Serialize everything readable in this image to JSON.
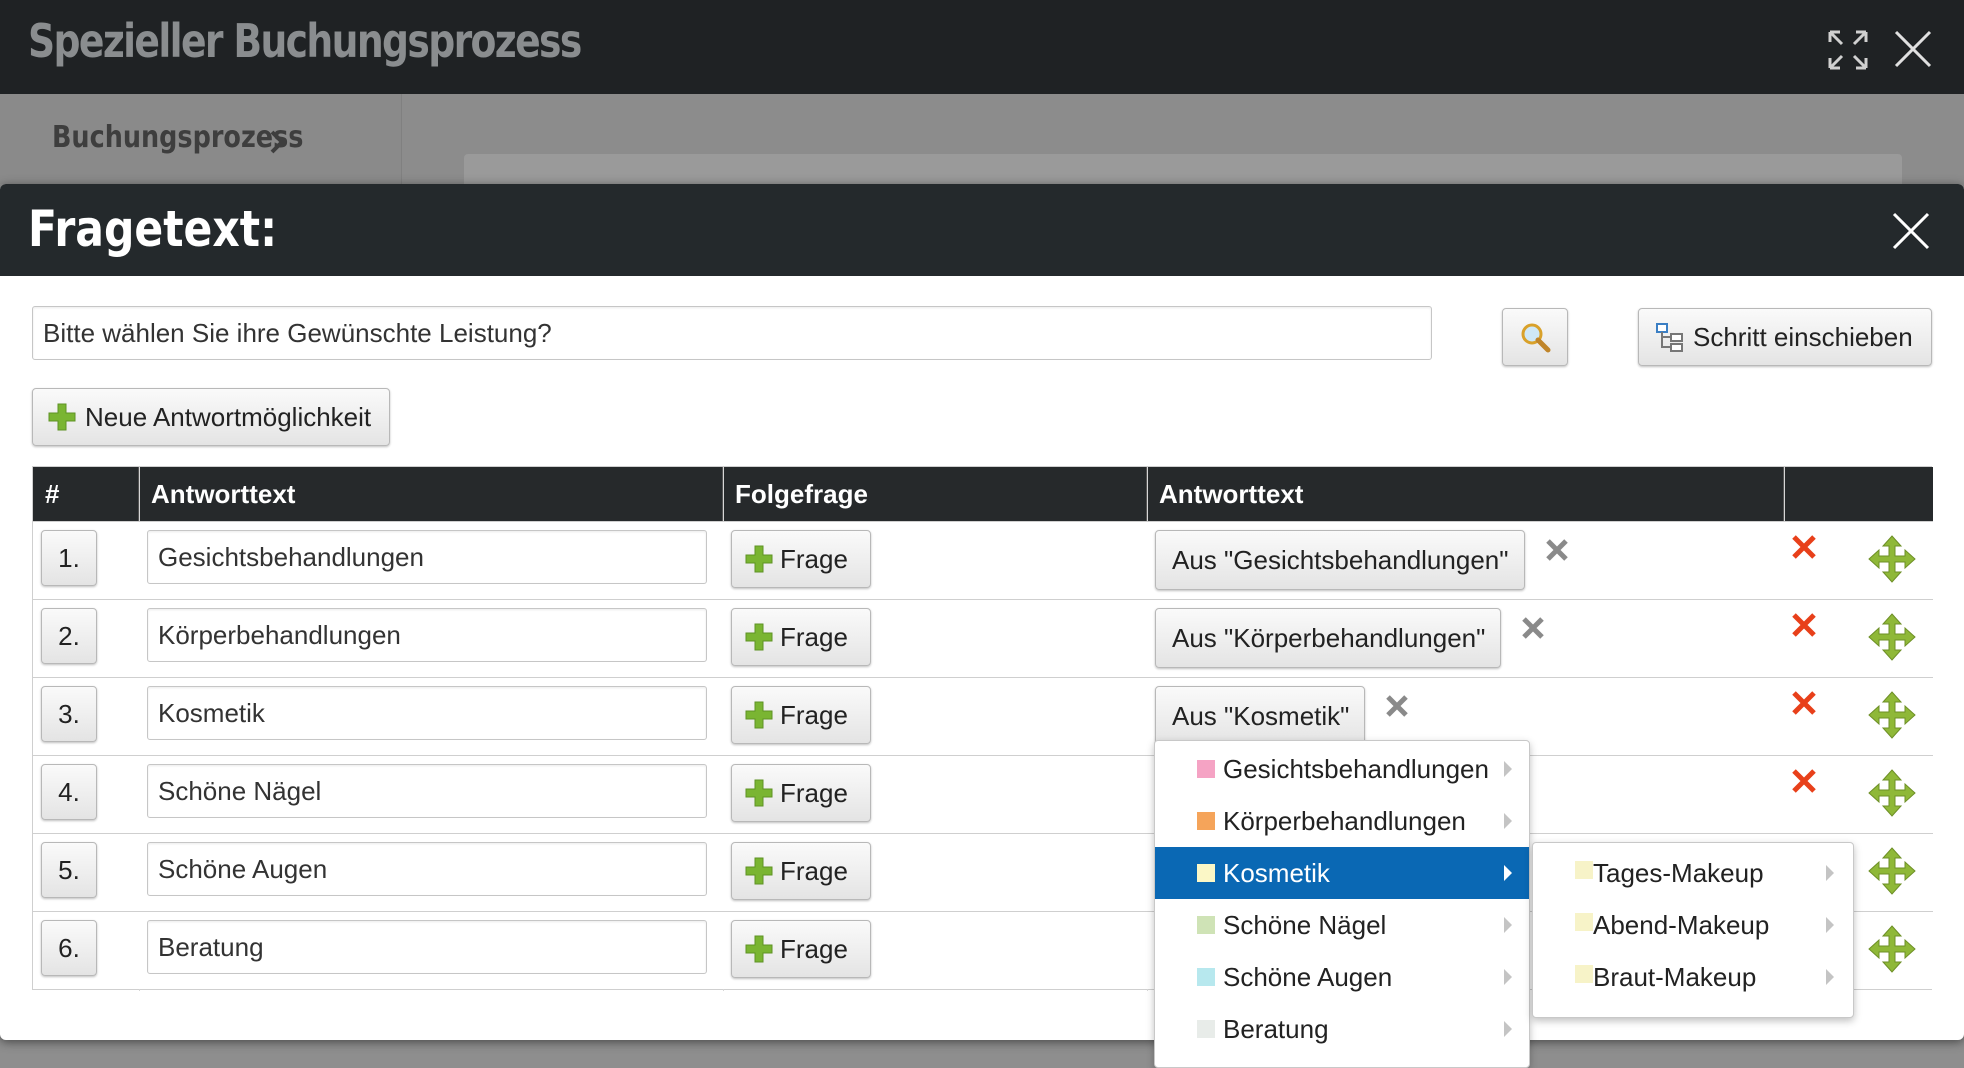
{
  "outer_window": {
    "title": "Spezieller Buchungsprozess",
    "breadcrumb": "Buchungsprozess"
  },
  "modal": {
    "title": "Fragetext:",
    "question_value": "Bitte wählen Sie ihre Gewünschte Leistung?",
    "insert_step_label": "Schritt einschieben",
    "new_answer_label": "Neue Antwortmöglichkeit"
  },
  "table": {
    "headers": [
      "#",
      "Antworttext",
      "Folgefrage",
      "Antworttext",
      ""
    ],
    "followup_label": "Frage",
    "rows": [
      {
        "num": "1.",
        "answer": "Gesichtsbehandlungen",
        "source": "Aus \"Gesichtsbehandlungen\""
      },
      {
        "num": "2.",
        "answer": "Körperbehandlungen",
        "source": "Aus \"Körperbehandlungen\""
      },
      {
        "num": "3.",
        "answer": "Kosmetik",
        "source": "Aus \"Kosmetik\""
      },
      {
        "num": "4.",
        "answer": "Schöne Nägel",
        "source": ""
      },
      {
        "num": "5.",
        "answer": "Schöne Augen",
        "source": ""
      },
      {
        "num": "6.",
        "answer": "Beratung",
        "source": ""
      }
    ]
  },
  "dropdown": {
    "items": [
      {
        "label": "Gesichtsbehandlungen",
        "color": "#f5a3c4"
      },
      {
        "label": "Körperbehandlungen",
        "color": "#f5a45a"
      },
      {
        "label": "Kosmetik",
        "color": "#fbf7c6"
      },
      {
        "label": "Schöne Nägel",
        "color": "#cfe3b6"
      },
      {
        "label": "Schöne Augen",
        "color": "#b7e8ee"
      },
      {
        "label": "Beratung",
        "color": "#e8ece9"
      }
    ],
    "active": "Kosmetik"
  },
  "submenu": {
    "items": [
      "Tages-Makeup",
      "Abend-Makeup",
      "Braut-Makeup"
    ]
  },
  "colors": {
    "accent": "#0a68b4",
    "delete": "#e8401a",
    "add": "#7ab532",
    "move": "#8fb838"
  }
}
